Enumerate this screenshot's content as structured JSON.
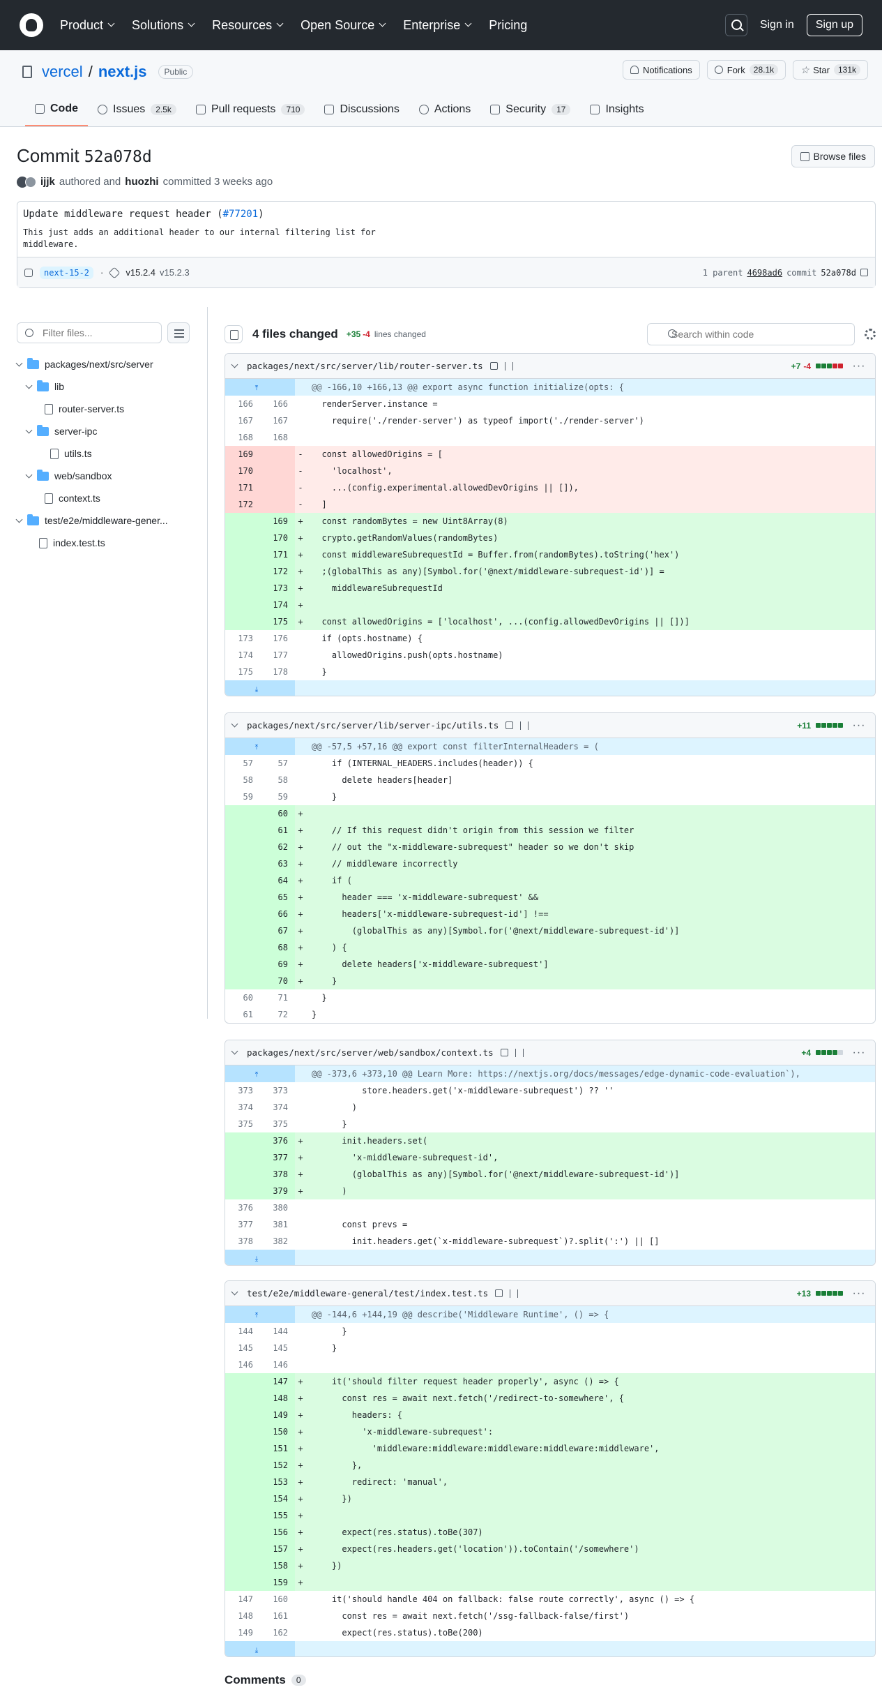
{
  "nav": {
    "items": [
      "Product",
      "Solutions",
      "Resources",
      "Open Source",
      "Enterprise",
      "Pricing"
    ],
    "sign_in": "Sign in",
    "sign_up": "Sign up"
  },
  "repo": {
    "owner": "vercel",
    "separator": "/",
    "name": "next.js",
    "visibility": "Public",
    "notifications_label": "Notifications",
    "fork_label": "Fork",
    "fork_count": "28.1k",
    "star_label": "Star",
    "star_count": "131k",
    "tabs": [
      {
        "label": "Code",
        "count": ""
      },
      {
        "label": "Issues",
        "count": "2.5k"
      },
      {
        "label": "Pull requests",
        "count": "710"
      },
      {
        "label": "Discussions",
        "count": ""
      },
      {
        "label": "Actions",
        "count": ""
      },
      {
        "label": "Security",
        "count": "17"
      },
      {
        "label": "Insights",
        "count": ""
      }
    ]
  },
  "commit": {
    "title_prefix": "Commit",
    "sha": "52a078d",
    "browse_files": "Browse files",
    "author": "ijjk",
    "authored_text": "authored and",
    "committer": "huozhi",
    "committed_text": "committed 3 weeks ago",
    "message": "Update middleware request header (",
    "pr_link": "#77201",
    "message_end": ")",
    "body": "This just adds an additional header to our internal filtering list for middleware.",
    "branch": "next-15-2",
    "tag_current": "v15.2.4",
    "tag_prev": "v15.2.3",
    "parent_label": "1 parent",
    "parent_sha": "4698ad6",
    "commit_label": "commit",
    "commit_sha": "52a078d"
  },
  "sidebar": {
    "filter_placeholder": "Filter files...",
    "tree": [
      {
        "label": "packages/next/src/server",
        "type": "folder",
        "depth": 0
      },
      {
        "label": "lib",
        "type": "folder",
        "depth": 1
      },
      {
        "label": "router-server.ts",
        "type": "file",
        "depth": 2
      },
      {
        "label": "server-ipc",
        "type": "folder",
        "depth": 1
      },
      {
        "label": "utils.ts",
        "type": "file",
        "depth": 2
      },
      {
        "label": "web/sandbox",
        "type": "folder",
        "depth": 1
      },
      {
        "label": "context.ts",
        "type": "file",
        "depth": 2
      },
      {
        "label": "test/e2e/middleware-gener...",
        "type": "folder",
        "depth": 0
      },
      {
        "label": "index.test.ts",
        "type": "file",
        "depth": 1
      }
    ]
  },
  "diff_toolbar": {
    "files_changed": "4 files changed",
    "additions": "+35",
    "deletions": "-4",
    "lines_changed": "lines changed",
    "search_placeholder": "Search within code"
  },
  "files": [
    {
      "path": "packages/next/src/server/lib/router-server.ts",
      "additions": "+7",
      "deletions": "-4",
      "blocks": [
        "add",
        "add",
        "add",
        "del",
        "del"
      ],
      "lines": [
        {
          "t": "hunk",
          "o": "",
          "n": "",
          "s": "",
          "c": "@@ -166,10 +166,13 @@ export async function initialize(opts: {"
        },
        {
          "t": "ctx",
          "o": "166",
          "n": "166",
          "s": "",
          "c": "  renderServer.instance ="
        },
        {
          "t": "ctx",
          "o": "167",
          "n": "167",
          "s": "",
          "c": "    require('./render-server') as typeof import('./render-server')"
        },
        {
          "t": "ctx",
          "o": "168",
          "n": "168",
          "s": "",
          "c": ""
        },
        {
          "t": "del",
          "o": "169",
          "n": "",
          "s": "-",
          "c": "  const allowedOrigins = ["
        },
        {
          "t": "del",
          "o": "170",
          "n": "",
          "s": "-",
          "c": "    'localhost',"
        },
        {
          "t": "del",
          "o": "171",
          "n": "",
          "s": "-",
          "c": "    ...(config.experimental.allowedDevOrigins || []),"
        },
        {
          "t": "del",
          "o": "172",
          "n": "",
          "s": "-",
          "c": "  ]"
        },
        {
          "t": "add",
          "o": "",
          "n": "169",
          "s": "+",
          "c": "  const randomBytes = new Uint8Array(8)"
        },
        {
          "t": "add",
          "o": "",
          "n": "170",
          "s": "+",
          "c": "  crypto.getRandomValues(randomBytes)"
        },
        {
          "t": "add",
          "o": "",
          "n": "171",
          "s": "+",
          "c": "  const middlewareSubrequestId = Buffer.from(randomBytes).toString('hex')"
        },
        {
          "t": "add",
          "o": "",
          "n": "172",
          "s": "+",
          "c": "  ;(globalThis as any)[Symbol.for('@next/middleware-subrequest-id')] ="
        },
        {
          "t": "add",
          "o": "",
          "n": "173",
          "s": "+",
          "c": "    middlewareSubrequestId"
        },
        {
          "t": "add",
          "o": "",
          "n": "174",
          "s": "+",
          "c": ""
        },
        {
          "t": "add",
          "o": "",
          "n": "175",
          "s": "+",
          "c": "  const allowedOrigins = ['localhost', ...(config.allowedDevOrigins || [])]"
        },
        {
          "t": "ctx",
          "o": "173",
          "n": "176",
          "s": "",
          "c": "  if (opts.hostname) {"
        },
        {
          "t": "ctx",
          "o": "174",
          "n": "177",
          "s": "",
          "c": "    allowedOrigins.push(opts.hostname)"
        },
        {
          "t": "ctx",
          "o": "175",
          "n": "178",
          "s": "",
          "c": "  }"
        },
        {
          "t": "expand",
          "o": "",
          "n": "",
          "s": "",
          "c": ""
        }
      ]
    },
    {
      "path": "packages/next/src/server/lib/server-ipc/utils.ts",
      "additions": "+11",
      "deletions": "",
      "blocks": [
        "add",
        "add",
        "add",
        "add",
        "add"
      ],
      "lines": [
        {
          "t": "hunk",
          "o": "",
          "n": "",
          "s": "",
          "c": "@@ -57,5 +57,16 @@ export const filterInternalHeaders = ("
        },
        {
          "t": "ctx",
          "o": "57",
          "n": "57",
          "s": "",
          "c": "    if (INTERNAL_HEADERS.includes(header)) {"
        },
        {
          "t": "ctx",
          "o": "58",
          "n": "58",
          "s": "",
          "c": "      delete headers[header]"
        },
        {
          "t": "ctx",
          "o": "59",
          "n": "59",
          "s": "",
          "c": "    }"
        },
        {
          "t": "add",
          "o": "",
          "n": "60",
          "s": "+",
          "c": ""
        },
        {
          "t": "add",
          "o": "",
          "n": "61",
          "s": "+",
          "c": "    // If this request didn't origin from this session we filter"
        },
        {
          "t": "add",
          "o": "",
          "n": "62",
          "s": "+",
          "c": "    // out the \"x-middleware-subrequest\" header so we don't skip"
        },
        {
          "t": "add",
          "o": "",
          "n": "63",
          "s": "+",
          "c": "    // middleware incorrectly"
        },
        {
          "t": "add",
          "o": "",
          "n": "64",
          "s": "+",
          "c": "    if ("
        },
        {
          "t": "add",
          "o": "",
          "n": "65",
          "s": "+",
          "c": "      header === 'x-middleware-subrequest' &&"
        },
        {
          "t": "add",
          "o": "",
          "n": "66",
          "s": "+",
          "c": "      headers['x-middleware-subrequest-id'] !=="
        },
        {
          "t": "add",
          "o": "",
          "n": "67",
          "s": "+",
          "c": "        (globalThis as any)[Symbol.for('@next/middleware-subrequest-id')]"
        },
        {
          "t": "add",
          "o": "",
          "n": "68",
          "s": "+",
          "c": "    ) {"
        },
        {
          "t": "add",
          "o": "",
          "n": "69",
          "s": "+",
          "c": "      delete headers['x-middleware-subrequest']"
        },
        {
          "t": "add",
          "o": "",
          "n": "70",
          "s": "+",
          "c": "    }"
        },
        {
          "t": "ctx",
          "o": "60",
          "n": "71",
          "s": "",
          "c": "  }"
        },
        {
          "t": "ctx",
          "o": "61",
          "n": "72",
          "s": "",
          "c": "}"
        }
      ]
    },
    {
      "path": "packages/next/src/server/web/sandbox/context.ts",
      "additions": "+4",
      "deletions": "",
      "blocks": [
        "add",
        "add",
        "add",
        "add",
        "neutral"
      ],
      "lines": [
        {
          "t": "hunk",
          "o": "",
          "n": "",
          "s": "",
          "c": "@@ -373,6 +373,10 @@ Learn More: https://nextjs.org/docs/messages/edge-dynamic-code-evaluation`),"
        },
        {
          "t": "ctx",
          "o": "373",
          "n": "373",
          "s": "",
          "c": "          store.headers.get('x-middleware-subrequest') ?? ''"
        },
        {
          "t": "ctx",
          "o": "374",
          "n": "374",
          "s": "",
          "c": "        )"
        },
        {
          "t": "ctx",
          "o": "375",
          "n": "375",
          "s": "",
          "c": "      }"
        },
        {
          "t": "add",
          "o": "",
          "n": "376",
          "s": "+",
          "c": "      init.headers.set("
        },
        {
          "t": "add",
          "o": "",
          "n": "377",
          "s": "+",
          "c": "        'x-middleware-subrequest-id',"
        },
        {
          "t": "add",
          "o": "",
          "n": "378",
          "s": "+",
          "c": "        (globalThis as any)[Symbol.for('@next/middleware-subrequest-id')]"
        },
        {
          "t": "add",
          "o": "",
          "n": "379",
          "s": "+",
          "c": "      )"
        },
        {
          "t": "ctx",
          "o": "376",
          "n": "380",
          "s": "",
          "c": ""
        },
        {
          "t": "ctx",
          "o": "377",
          "n": "381",
          "s": "",
          "c": "      const prevs ="
        },
        {
          "t": "ctx",
          "o": "378",
          "n": "382",
          "s": "",
          "c": "        init.headers.get(`x-middleware-subrequest`)?.split(':') || []"
        },
        {
          "t": "expand",
          "o": "",
          "n": "",
          "s": "",
          "c": ""
        }
      ]
    },
    {
      "path": "test/e2e/middleware-general/test/index.test.ts",
      "additions": "+13",
      "deletions": "",
      "blocks": [
        "add",
        "add",
        "add",
        "add",
        "add"
      ],
      "lines": [
        {
          "t": "hunk",
          "o": "",
          "n": "",
          "s": "",
          "c": "@@ -144,6 +144,19 @@ describe('Middleware Runtime', () => {"
        },
        {
          "t": "ctx",
          "o": "144",
          "n": "144",
          "s": "",
          "c": "      }"
        },
        {
          "t": "ctx",
          "o": "145",
          "n": "145",
          "s": "",
          "c": "    }"
        },
        {
          "t": "ctx",
          "o": "146",
          "n": "146",
          "s": "",
          "c": ""
        },
        {
          "t": "add",
          "o": "",
          "n": "147",
          "s": "+",
          "c": "    it('should filter request header properly', async () => {"
        },
        {
          "t": "add",
          "o": "",
          "n": "148",
          "s": "+",
          "c": "      const res = await next.fetch('/redirect-to-somewhere', {"
        },
        {
          "t": "add",
          "o": "",
          "n": "149",
          "s": "+",
          "c": "        headers: {"
        },
        {
          "t": "add",
          "o": "",
          "n": "150",
          "s": "+",
          "c": "          'x-middleware-subrequest':"
        },
        {
          "t": "add",
          "o": "",
          "n": "151",
          "s": "+",
          "c": "            'middleware:middleware:middleware:middleware:middleware',"
        },
        {
          "t": "add",
          "o": "",
          "n": "152",
          "s": "+",
          "c": "        },"
        },
        {
          "t": "add",
          "o": "",
          "n": "153",
          "s": "+",
          "c": "        redirect: 'manual',"
        },
        {
          "t": "add",
          "o": "",
          "n": "154",
          "s": "+",
          "c": "      })"
        },
        {
          "t": "add",
          "o": "",
          "n": "155",
          "s": "+",
          "c": ""
        },
        {
          "t": "add",
          "o": "",
          "n": "156",
          "s": "+",
          "c": "      expect(res.status).toBe(307)"
        },
        {
          "t": "add",
          "o": "",
          "n": "157",
          "s": "+",
          "c": "      expect(res.headers.get('location')).toContain('/somewhere')"
        },
        {
          "t": "add",
          "o": "",
          "n": "158",
          "s": "+",
          "c": "    })"
        },
        {
          "t": "add",
          "o": "",
          "n": "159",
          "s": "+",
          "c": ""
        },
        {
          "t": "ctx",
          "o": "147",
          "n": "160",
          "s": "",
          "c": "    it('should handle 404 on fallback: false route correctly', async () => {"
        },
        {
          "t": "ctx",
          "o": "148",
          "n": "161",
          "s": "",
          "c": "      const res = await next.fetch('/ssg-fallback-false/first')"
        },
        {
          "t": "ctx",
          "o": "149",
          "n": "162",
          "s": "",
          "c": "      expect(res.status).toBe(200)"
        },
        {
          "t": "expand",
          "o": "",
          "n": "",
          "s": "",
          "c": ""
        }
      ]
    }
  ],
  "comments": {
    "label": "Comments",
    "count": "0"
  },
  "colors": {
    "add_block": "#1a7f37",
    "del_block": "#cf222e",
    "neutral_block": "#d0d7de"
  }
}
